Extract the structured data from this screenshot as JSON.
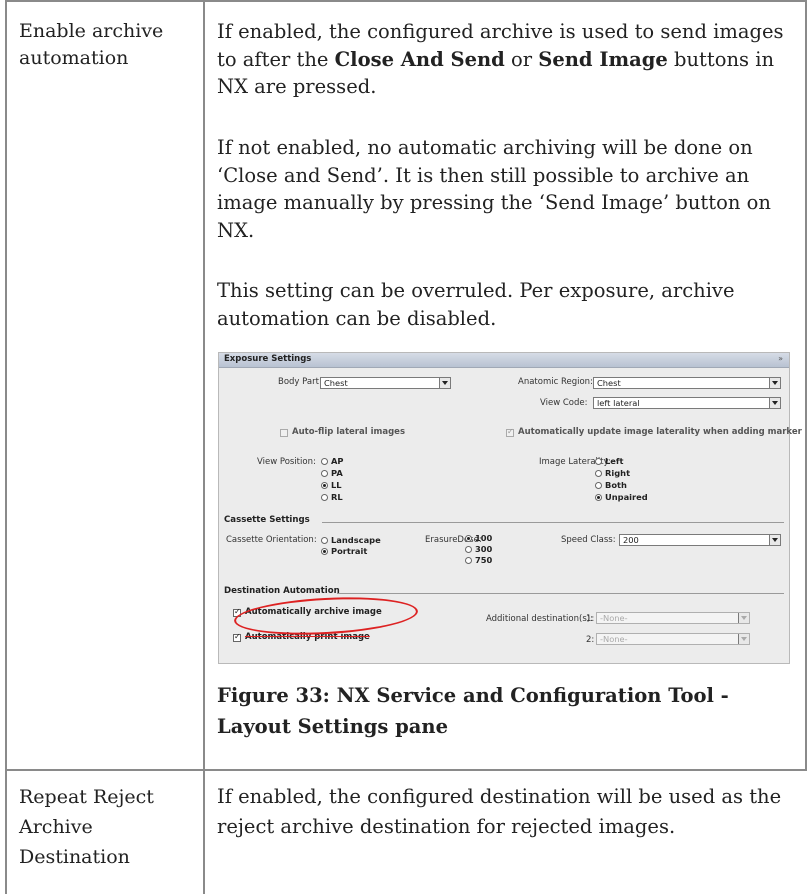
{
  "rows": [
    {
      "label": "Enable archive automation",
      "paragraphs": [
        {
          "pre": "If enabled, the configured archive is used to send images to after the ",
          "b1": "Close And Send",
          "mid": " or ",
          "b2": "Send Image",
          "post": " buttons in NX are pressed."
        },
        {
          "text": "If not enabled, no automatic archiving will be done on ‘Close and Send’. It is then still possible to archive an image manually by pressing the ‘Send Image’ button on NX."
        },
        {
          "text": "This setting can be overruled. Per exposure, archive automation can be disabled."
        }
      ],
      "caption": "Figure 33: NX Service and Configuration Tool - Layout Settings pane"
    },
    {
      "label": "Repeat Reject Archive Destination",
      "paragraphs": [
        {
          "text": "If enabled, the configured destination will be used as the reject archive destination for rejected images."
        }
      ]
    }
  ],
  "screenshot": {
    "title": "Exposure Settings",
    "collapse_glyph": "»",
    "body_part_label": "Body Part:",
    "body_part_value": "Chest",
    "anatomic_region_label": "Anatomic Region:",
    "anatomic_region_value": "Chest",
    "view_code_label": "View Code:",
    "view_code_value": "left lateral",
    "auto_flip_label": "Auto-flip lateral images",
    "auto_update_label": "Automatically update image laterality when adding marker",
    "view_position_label": "View Position:",
    "view_positions": [
      {
        "label": "AP",
        "selected": false
      },
      {
        "label": "PA",
        "selected": false
      },
      {
        "label": "LL",
        "selected": true
      },
      {
        "label": "RL",
        "selected": false
      }
    ],
    "image_laterality_label": "Image Laterality:",
    "lateralities": [
      {
        "label": "Left",
        "selected": false
      },
      {
        "label": "Right",
        "selected": false
      },
      {
        "label": "Both",
        "selected": false
      },
      {
        "label": "Unpaired",
        "selected": true
      }
    ],
    "cassette_group": "Cassette Settings",
    "cassette_orientation_label": "Cassette Orientation:",
    "orientations": [
      {
        "label": "Landscape",
        "selected": false
      },
      {
        "label": "Portrait",
        "selected": true
      }
    ],
    "erasure_label": "ErasureDose:",
    "erasure_doses": [
      {
        "label": "100",
        "selected": true
      },
      {
        "label": "300",
        "selected": false
      },
      {
        "label": "750",
        "selected": false
      }
    ],
    "speed_class_label": "Speed Class:",
    "speed_class_value": "200",
    "destination_group": "Destination Automation",
    "auto_archive_label": "Automatically archive image",
    "auto_print_label": "Automatically print image",
    "additional_dest_label": "Additional destination(s):",
    "dest1_index": "1:",
    "dest1_value": "-None-",
    "dest2_index": "2:",
    "dest2_value": "-None-"
  }
}
